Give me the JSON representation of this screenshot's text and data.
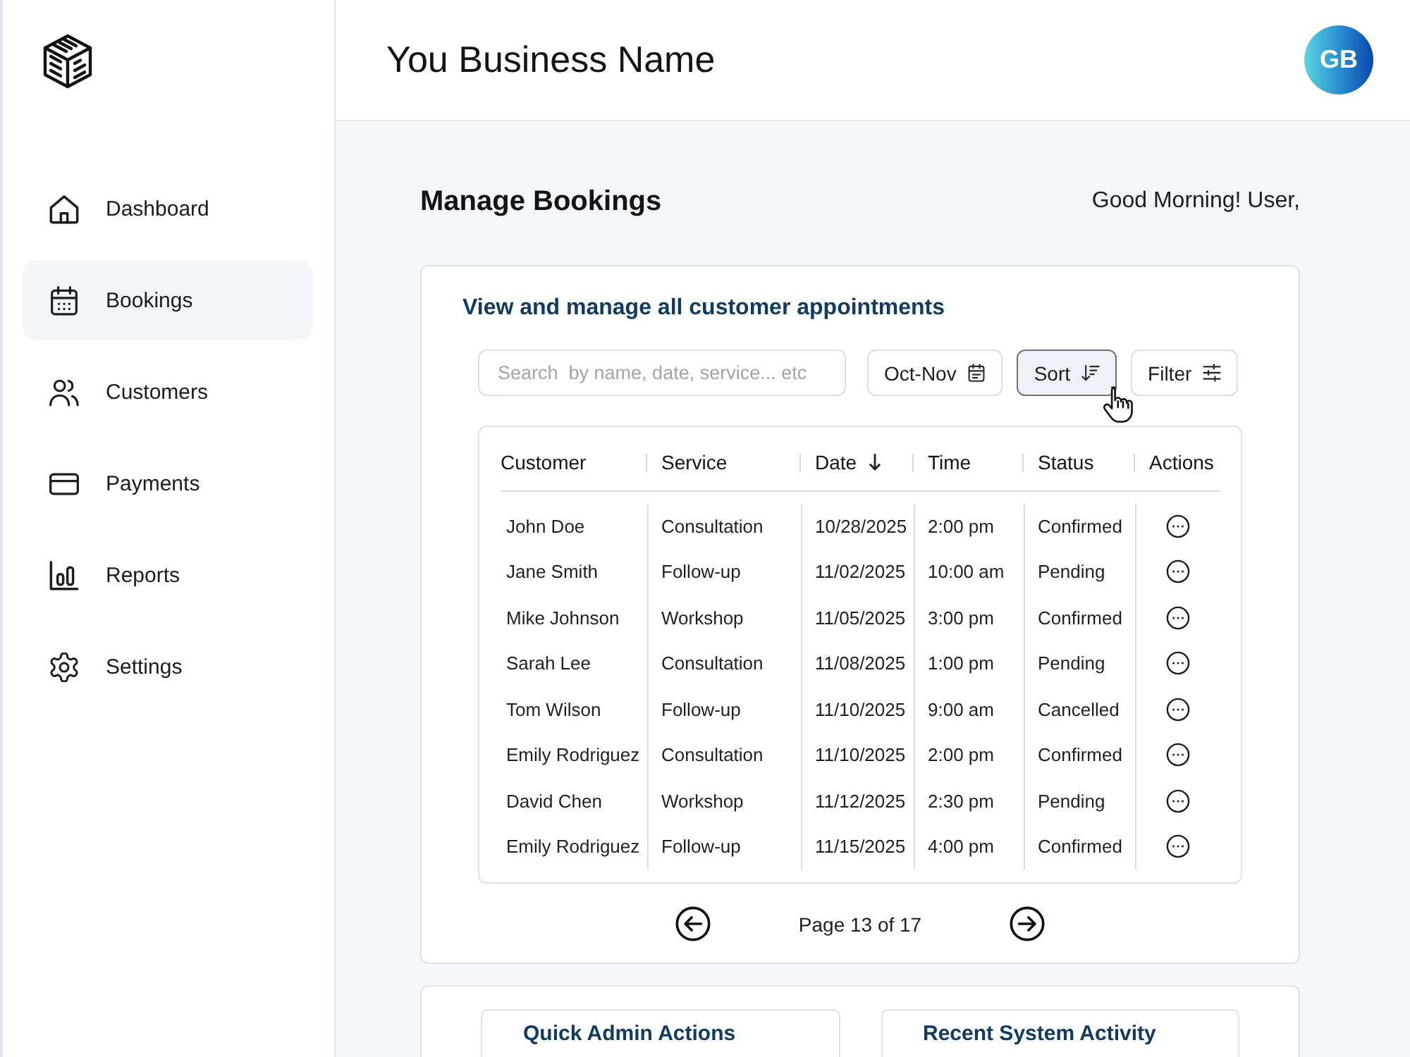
{
  "sidebar": {
    "items": [
      {
        "label": "Dashboard",
        "kind": "home",
        "selected": false
      },
      {
        "label": "Bookings",
        "kind": "calendar",
        "selected": true
      },
      {
        "label": "Customers",
        "kind": "users",
        "selected": false
      },
      {
        "label": "Payments",
        "kind": "card",
        "selected": false
      },
      {
        "label": "Reports",
        "kind": "chart",
        "selected": false
      },
      {
        "label": "Settings",
        "kind": "gear",
        "selected": false
      }
    ]
  },
  "header": {
    "title": "You Business Name",
    "avatar": {
      "initials": "GB"
    }
  },
  "page": {
    "title": "Manage Bookings",
    "greeting": "Good Morning! User,"
  },
  "bookings_card": {
    "title": "View and manage all customer appointments",
    "search": {
      "placeholder": "Search  by name, date, service... etc"
    },
    "controls": [
      {
        "label": "Oct-Nov",
        "kind": "date_range",
        "selected": false
      },
      {
        "label": "Sort",
        "kind": "sort",
        "selected": true
      },
      {
        "label": "Filter",
        "kind": "filter",
        "selected": false
      }
    ],
    "table": {
      "columns": [
        {
          "label": "Customer",
          "sorted": false
        },
        {
          "label": "Service",
          "sorted": false
        },
        {
          "label": "Date",
          "sorted": true
        },
        {
          "label": "Time",
          "sorted": false
        },
        {
          "label": "Status",
          "sorted": false
        },
        {
          "label": "Actions",
          "sorted": false
        }
      ],
      "rows": [
        [
          "John Doe",
          "Consultation",
          "10/28/2025",
          "2:00 pm",
          "Confirmed"
        ],
        [
          "Jane Smith",
          "Follow-up",
          "11/02/2025",
          "10:00 am",
          "Pending"
        ],
        [
          "Mike Johnson",
          "Workshop",
          "11/05/2025",
          "3:00 pm",
          "Confirmed"
        ],
        [
          "Sarah Lee",
          "Consultation",
          "11/08/2025",
          "1:00 pm",
          "Pending"
        ],
        [
          "Tom Wilson",
          "Follow-up",
          "11/10/2025",
          "9:00 am",
          "Cancelled"
        ],
        [
          "Emily Rodriguez",
          "Consultation",
          "11/10/2025",
          "2:00 pm",
          "Confirmed"
        ],
        [
          "David Chen",
          "Workshop",
          "11/12/2025",
          "2:30 pm",
          "Pending"
        ],
        [
          "Emily Rodriguez",
          "Follow-up",
          "11/15/2025",
          "4:00 pm",
          "Confirmed"
        ]
      ]
    },
    "pagination": {
      "label": "Page 13 of 17"
    }
  },
  "bottom_panels": [
    {
      "title": "Quick Admin Actions"
    },
    {
      "title": "Recent System Activity"
    }
  ]
}
